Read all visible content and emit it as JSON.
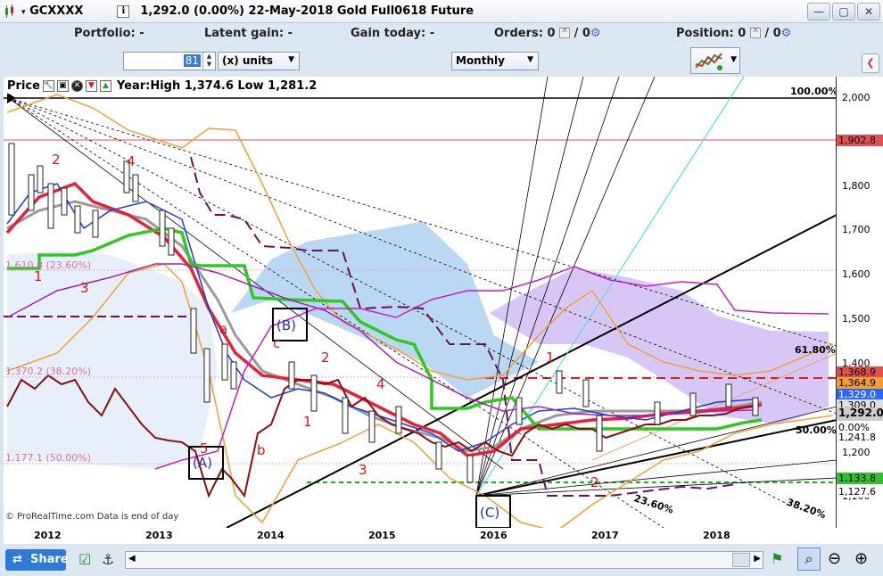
{
  "title": {
    "symbol": "GCXXXX",
    "info": "i",
    "description": "1,292.0 (0.00%)  22-May-2018 Gold Full0618 Future"
  },
  "toolbar": {
    "portfolio": "Portfolio: -",
    "latent_gain": "Latent gain: -",
    "gain_today": "Gain today: -",
    "orders_label": "Orders: 0",
    "orders_slash": "/ 0",
    "position_label": "Position: 0",
    "position_slash": "/ 0"
  },
  "controls": {
    "units_value": "81",
    "units_label": "(x) units",
    "period": "Monthly"
  },
  "legend": {
    "label": "Price",
    "year_stats": "Year:High 1,374.6 Low 1,281.2"
  },
  "price_axis": [
    "2,000",
    "1,900",
    "1,800",
    "1,700",
    "1,600",
    "1,500",
    "1,400",
    "1,300",
    "1,200",
    "1,100"
  ],
  "price_tags": [
    {
      "text": "1,902.8",
      "color": "#e05050"
    },
    {
      "text": "1,368.9",
      "color": "#e05050"
    },
    {
      "text": "1,364.9",
      "color": "#f0a030"
    },
    {
      "text": "1,329.0",
      "color": "#2a66ff"
    },
    {
      "text": "1,309.0",
      "color": "#e0e0e0"
    },
    {
      "text": "1,292.0",
      "color": "#cccccc"
    },
    {
      "text": "0.00%",
      "color": "#ffffff"
    },
    {
      "text": "1,241.8",
      "color": "#ffffff"
    },
    {
      "text": "1,133.8",
      "color": "#30c030"
    },
    {
      "text": "1,127.6",
      "color": "#ffffff"
    }
  ],
  "fib_labels": [
    "100.00%",
    "61.80%",
    "50.00%",
    "38.20%",
    "23.60%"
  ],
  "left_fib_labels": [
    "1,610.8 (23.60%)",
    "1,370.2 (38.20%)",
    "1,177.1 (50.00%)"
  ],
  "wave_labels": [
    "1",
    "2",
    "3",
    "4",
    "5",
    "a",
    "b",
    "c",
    "(A)",
    "(B)",
    "(C)",
    "1",
    "2",
    "3",
    "4",
    "1",
    "2"
  ],
  "x_axis": [
    "2012",
    "2013",
    "2014",
    "2015",
    "2016",
    "2017",
    "2018"
  ],
  "watermark": "© ProRealTime.com   Data is end of day",
  "share_label": "Share",
  "colors": {
    "ichimoku_cloud_blue": "#9cc8ee",
    "ichimoku_cloud_purple": "#c8b4f4",
    "ma_red": "#e8203a",
    "ma_green": "#2ec820",
    "ma_blue": "#1a3cd8",
    "ma_purple": "#b020c8",
    "osc_brown": "#8a1010"
  }
}
